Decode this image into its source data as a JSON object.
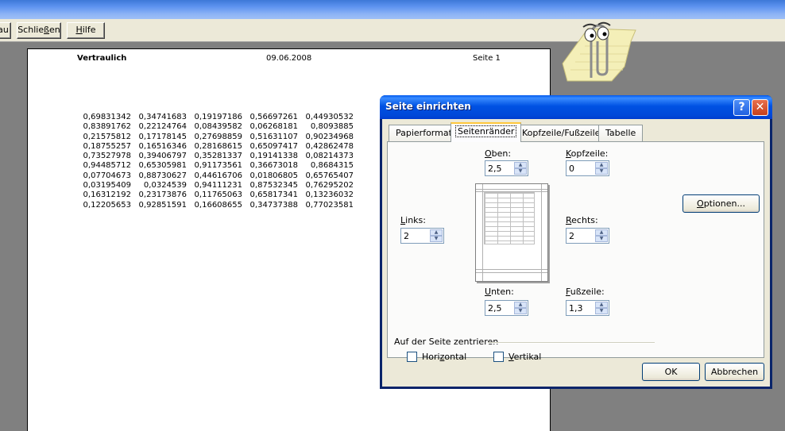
{
  "toolbar": {
    "partial_label": "au",
    "close": {
      "pre": "Schlie",
      "key": "ß",
      "post": "en"
    },
    "help": {
      "key": "H",
      "post": "ilfe"
    }
  },
  "page": {
    "header_left": "Vertraulich",
    "header_center": "09.06.2008",
    "header_right": "Seite 1",
    "rows": [
      [
        "0,69831342",
        "0,34741683",
        "0,19197186",
        "0,56697261",
        "0,44930532"
      ],
      [
        "0,83891762",
        "0,22124764",
        "0,08439582",
        "0,06268181",
        "0,8093885"
      ],
      [
        "0,21575812",
        "0,17178145",
        "0,27698859",
        "0,51631107",
        "0,90234968"
      ],
      [
        "0,18755257",
        "0,16516346",
        "0,28168615",
        "0,65097417",
        "0,42862478"
      ],
      [
        "0,73527978",
        "0,39406797",
        "0,35281337",
        "0,19141338",
        "0,08214373"
      ],
      [
        "0,94485712",
        "0,65305981",
        "0,91173561",
        "0,36673018",
        "0,8684315"
      ],
      [
        "0,07704673",
        "0,88730627",
        "0,44616706",
        "0,01806805",
        "0,65765407"
      ],
      [
        "0,03195409",
        "0,0324539",
        "0,94111231",
        "0,87532345",
        "0,76295202"
      ],
      [
        "0,16312192",
        "0,23173876",
        "0,11765063",
        "0,65817341",
        "0,13236032"
      ],
      [
        "0,12205653",
        "0,92851591",
        "0,16608655",
        "0,34737388",
        "0,77023581"
      ]
    ]
  },
  "dialog": {
    "title": "Seite einrichten",
    "help_glyph": "?",
    "close_glyph": "✕",
    "tabs": [
      "Papierformat",
      "Seitenränder",
      "Kopfzeile/Fußzeile",
      "Tabelle"
    ],
    "active_tab": "Seitenränder",
    "fields": {
      "top": {
        "pre": "",
        "key": "O",
        "post": "ben:",
        "value": "2,5"
      },
      "header": {
        "pre": "",
        "key": "K",
        "post": "opfzeile:",
        "value": "0"
      },
      "left": {
        "pre": "",
        "key": "L",
        "post": "inks:",
        "value": "2"
      },
      "right": {
        "pre": "",
        "key": "R",
        "post": "echts:",
        "value": "2"
      },
      "bottom": {
        "pre": "",
        "key": "U",
        "post": "nten:",
        "value": "2,5"
      },
      "footer": {
        "pre": "",
        "key": "F",
        "post": "ußzeile:",
        "value": "1,3"
      }
    },
    "options_button": {
      "key": "O",
      "post": "ptionen..."
    },
    "center_group": "Auf der Seite zentrieren",
    "horizontal": {
      "pre": "Hori",
      "key": "z",
      "post": "ontal",
      "checked": false
    },
    "vertical": {
      "pre": "",
      "key": "V",
      "post": "ertikal",
      "checked": false
    },
    "ok": "OK",
    "cancel": "Abbrechen"
  }
}
